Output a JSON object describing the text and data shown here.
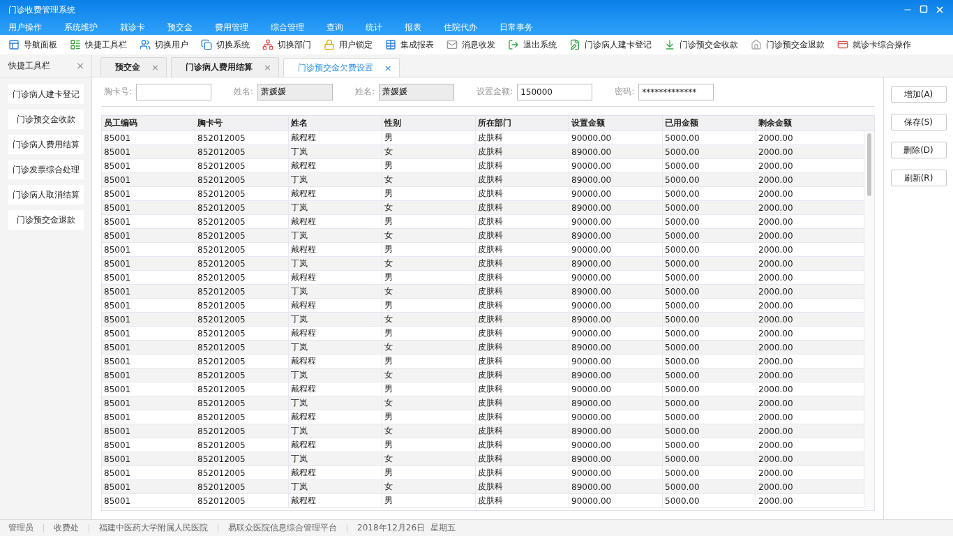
{
  "window": {
    "title": "门诊收费管理系统"
  },
  "menu": [
    "用户操作",
    "系统维护",
    "就诊卡",
    "预交金",
    "费用管理",
    "综合管理",
    "查询",
    "统计",
    "报表",
    "住院代办",
    "日常事务"
  ],
  "toolbar": [
    "导航面板",
    "快捷工具栏",
    "切换用户",
    "切换系统",
    "切换部门",
    "用户锁定",
    "集成报表",
    "消息收发",
    "退出系统",
    "门诊病人建卡登记",
    "门诊预交金收款",
    "门诊预交金退款",
    "就诊卡综合操作"
  ],
  "sidebar": {
    "title": "快捷工具栏",
    "close": "×",
    "items": [
      "门诊病人建卡登记",
      "门诊预交金收款",
      "门诊病人费用结算",
      "门诊发票综合处理",
      "门诊病人取消结算",
      "门诊预交金退款"
    ]
  },
  "tabs": [
    {
      "label": "预交金",
      "close": "×",
      "selected": false
    },
    {
      "label": "门诊病人费用结算",
      "close": "×",
      "selected": false
    },
    {
      "label": "门诊预交金欠费设置",
      "close": "×",
      "selected": true
    }
  ],
  "form": [
    {
      "label": "胸卡号:",
      "readonly": false
    },
    {
      "label": "姓名:",
      "value": "萧媛媛",
      "readonly": true
    },
    {
      "label": "姓名:",
      "value": "萧媛媛",
      "readonly": true
    },
    {
      "label": "设置金额:",
      "value": "150000",
      "readonly": false
    },
    {
      "label": "密码:",
      "value": "*************",
      "readonly": false
    }
  ],
  "table": {
    "columns": [
      "员工编码",
      "胸卡号",
      "姓名",
      "性别",
      "所在部门",
      "设置金额",
      "已用金额",
      "剩余金额"
    ],
    "rows": [
      [
        "85001",
        "852012005",
        "戴程程",
        "男",
        "皮肤科",
        "90000.00",
        "5000.00",
        "2000.00"
      ],
      [
        "85001",
        "852012005",
        "丁岚",
        "女",
        "皮肤科",
        "89000.00",
        "5000.00",
        "2000.00"
      ],
      [
        "85001",
        "852012005",
        "戴程程",
        "男",
        "皮肤科",
        "90000.00",
        "5000.00",
        "2000.00"
      ],
      [
        "85001",
        "852012005",
        "丁岚",
        "女",
        "皮肤科",
        "89000.00",
        "5000.00",
        "2000.00"
      ],
      [
        "85001",
        "852012005",
        "戴程程",
        "男",
        "皮肤科",
        "90000.00",
        "5000.00",
        "2000.00"
      ],
      [
        "85001",
        "852012005",
        "丁岚",
        "女",
        "皮肤科",
        "89000.00",
        "5000.00",
        "2000.00"
      ],
      [
        "85001",
        "852012005",
        "戴程程",
        "男",
        "皮肤科",
        "90000.00",
        "5000.00",
        "2000.00"
      ],
      [
        "85001",
        "852012005",
        "丁岚",
        "女",
        "皮肤科",
        "89000.00",
        "5000.00",
        "2000.00"
      ],
      [
        "85001",
        "852012005",
        "戴程程",
        "男",
        "皮肤科",
        "90000.00",
        "5000.00",
        "2000.00"
      ],
      [
        "85001",
        "852012005",
        "丁岚",
        "女",
        "皮肤科",
        "89000.00",
        "5000.00",
        "2000.00"
      ],
      [
        "85001",
        "852012005",
        "戴程程",
        "男",
        "皮肤科",
        "90000.00",
        "5000.00",
        "2000.00"
      ],
      [
        "85001",
        "852012005",
        "丁岚",
        "女",
        "皮肤科",
        "89000.00",
        "5000.00",
        "2000.00"
      ],
      [
        "85001",
        "852012005",
        "戴程程",
        "男",
        "皮肤科",
        "90000.00",
        "5000.00",
        "2000.00"
      ],
      [
        "85001",
        "852012005",
        "丁岚",
        "女",
        "皮肤科",
        "89000.00",
        "5000.00",
        "2000.00"
      ],
      [
        "85001",
        "852012005",
        "戴程程",
        "男",
        "皮肤科",
        "90000.00",
        "5000.00",
        "2000.00"
      ],
      [
        "85001",
        "852012005",
        "丁岚",
        "女",
        "皮肤科",
        "89000.00",
        "5000.00",
        "2000.00"
      ],
      [
        "85001",
        "852012005",
        "戴程程",
        "男",
        "皮肤科",
        "90000.00",
        "5000.00",
        "2000.00"
      ],
      [
        "85001",
        "852012005",
        "丁岚",
        "女",
        "皮肤科",
        "89000.00",
        "5000.00",
        "2000.00"
      ],
      [
        "85001",
        "852012005",
        "戴程程",
        "男",
        "皮肤科",
        "90000.00",
        "5000.00",
        "2000.00"
      ],
      [
        "85001",
        "852012005",
        "丁岚",
        "女",
        "皮肤科",
        "89000.00",
        "5000.00",
        "2000.00"
      ],
      [
        "85001",
        "852012005",
        "戴程程",
        "男",
        "皮肤科",
        "90000.00",
        "5000.00",
        "2000.00"
      ],
      [
        "85001",
        "852012005",
        "丁岚",
        "女",
        "皮肤科",
        "89000.00",
        "5000.00",
        "2000.00"
      ],
      [
        "85001",
        "852012005",
        "戴程程",
        "男",
        "皮肤科",
        "90000.00",
        "5000.00",
        "2000.00"
      ],
      [
        "85001",
        "852012005",
        "丁岚",
        "女",
        "皮肤科",
        "89000.00",
        "5000.00",
        "2000.00"
      ],
      [
        "85001",
        "852012005",
        "戴程程",
        "男",
        "皮肤科",
        "90000.00",
        "5000.00",
        "2000.00"
      ],
      [
        "85001",
        "852012005",
        "丁岚",
        "女",
        "皮肤科",
        "89000.00",
        "5000.00",
        "2000.00"
      ],
      [
        "85001",
        "852012005",
        "戴程程",
        "男",
        "皮肤科",
        "90000.00",
        "5000.00",
        "2000.00"
      ]
    ]
  },
  "actions": [
    "增加(A)",
    "保存(S)",
    "删除(D)",
    "刷新(R)"
  ],
  "status_bar": [
    "管理员",
    "收费处",
    "福建中医药大学附属人民医院",
    "易联众医院信息综合管理平台",
    "2018年12月26日  星期五"
  ]
}
